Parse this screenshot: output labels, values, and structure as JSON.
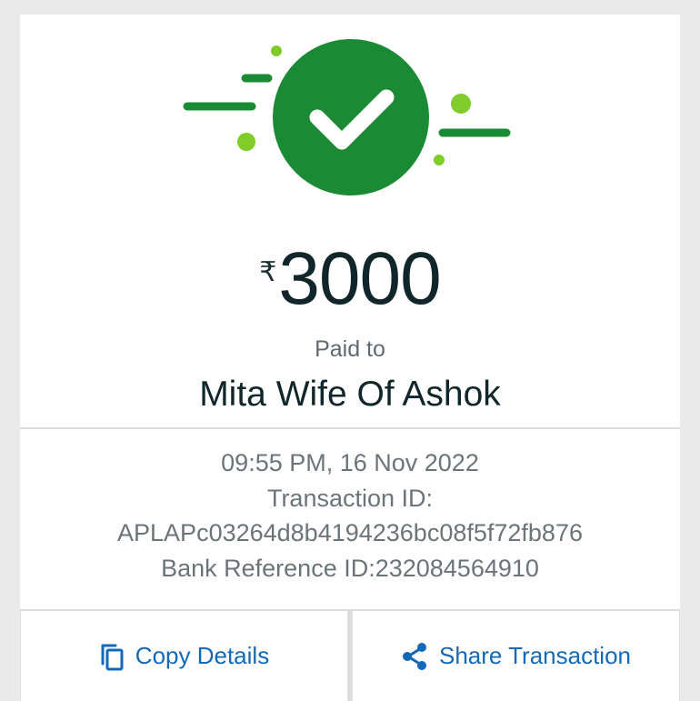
{
  "status": {
    "icon": "check-circle-icon",
    "colors": {
      "primary_green": "#1b8a35",
      "light_green": "#80cc28"
    }
  },
  "payment": {
    "currency_symbol": "₹",
    "amount": "3000",
    "paid_to_label": "Paid to",
    "payee_name": "Mita Wife Of Ashok"
  },
  "details": {
    "datetime": "09:55 PM, 16 Nov 2022",
    "transaction_id_label": "Transaction ID:",
    "transaction_id": "APLAPc03264d8b4194236bc08f5f72fb876",
    "bank_reference": "Bank Reference ID:232084564910"
  },
  "actions": {
    "copy_label": "Copy Details",
    "copy_icon": "copy-icon",
    "share_label": "Share Transaction",
    "share_icon": "share-icon",
    "link_color": "#1369b8"
  }
}
